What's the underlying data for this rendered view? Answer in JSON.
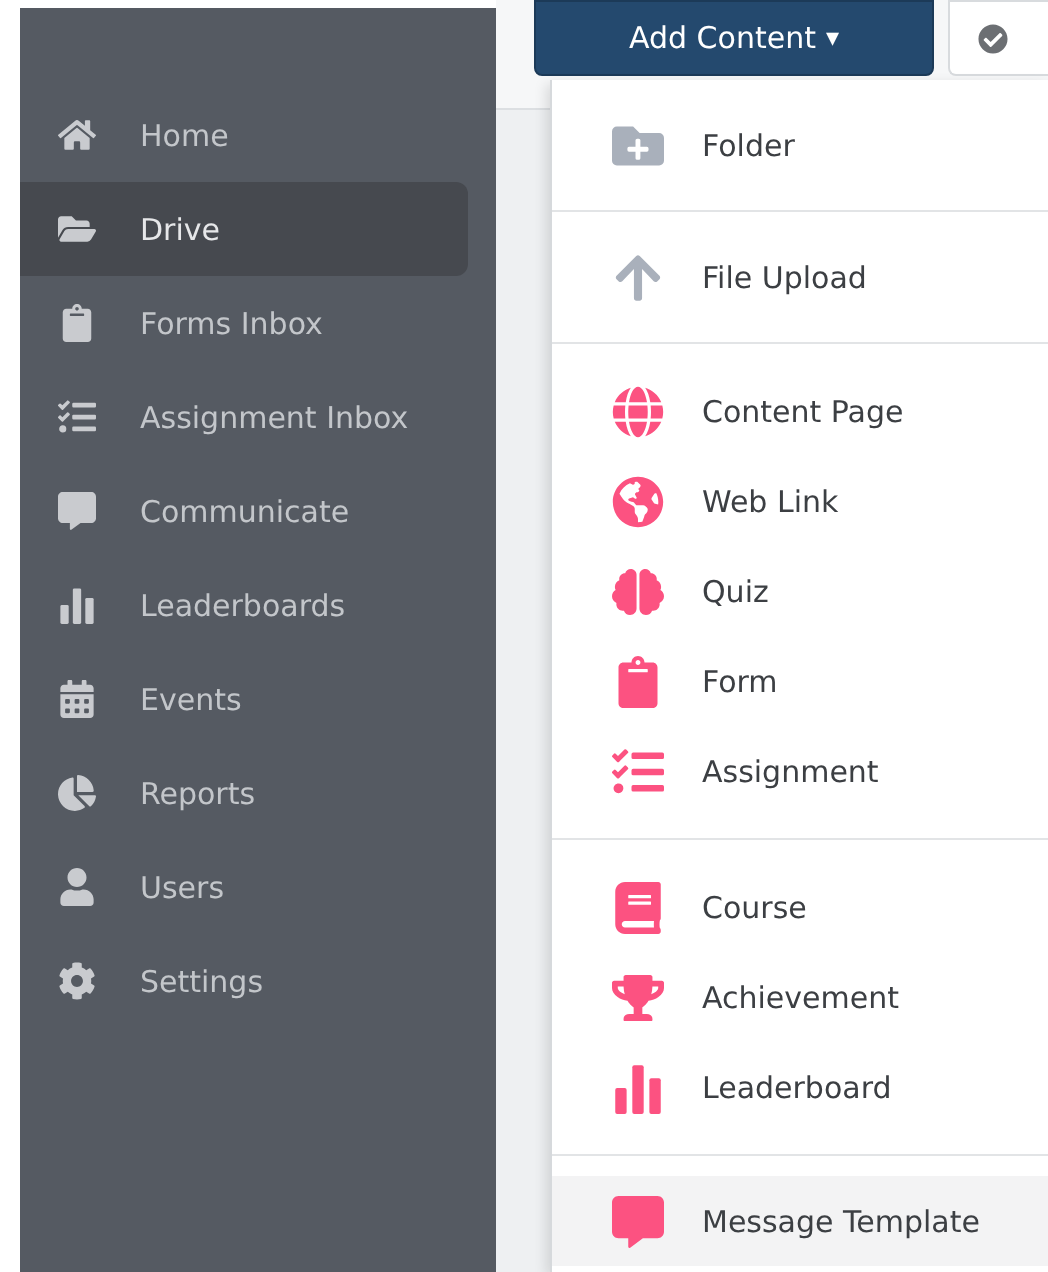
{
  "sidebar": {
    "items": [
      {
        "label": "Home",
        "selected": false
      },
      {
        "label": "Drive",
        "selected": true
      },
      {
        "label": "Forms Inbox",
        "selected": false
      },
      {
        "label": "Assignment Inbox",
        "selected": false
      },
      {
        "label": "Communicate",
        "selected": false
      },
      {
        "label": "Leaderboards",
        "selected": false
      },
      {
        "label": "Events",
        "selected": false
      },
      {
        "label": "Reports",
        "selected": false
      },
      {
        "label": "Users",
        "selected": false
      },
      {
        "label": "Settings",
        "selected": false
      }
    ]
  },
  "toolbar": {
    "add_button": {
      "label": "Add Content",
      "caret": "▾"
    }
  },
  "menu": {
    "sections": [
      {
        "items": [
          {
            "label": "Folder",
            "kind": "neutral",
            "hovered": false
          }
        ]
      },
      {
        "items": [
          {
            "label": "File Upload",
            "kind": "neutral",
            "hovered": false
          }
        ]
      },
      {
        "items": [
          {
            "label": "Content Page",
            "kind": "accent",
            "hovered": false
          },
          {
            "label": "Web Link",
            "kind": "accent",
            "hovered": false
          },
          {
            "label": "Quiz",
            "kind": "accent",
            "hovered": false
          },
          {
            "label": "Form",
            "kind": "accent",
            "hovered": false
          },
          {
            "label": "Assignment",
            "kind": "accent",
            "hovered": false
          }
        ]
      },
      {
        "items": [
          {
            "label": "Course",
            "kind": "accent",
            "hovered": false
          },
          {
            "label": "Achievement",
            "kind": "accent",
            "hovered": false
          },
          {
            "label": "Leaderboard",
            "kind": "accent",
            "hovered": false
          }
        ]
      },
      {
        "items": [
          {
            "label": "Message Template",
            "kind": "accent",
            "hovered": true
          }
        ]
      }
    ]
  }
}
